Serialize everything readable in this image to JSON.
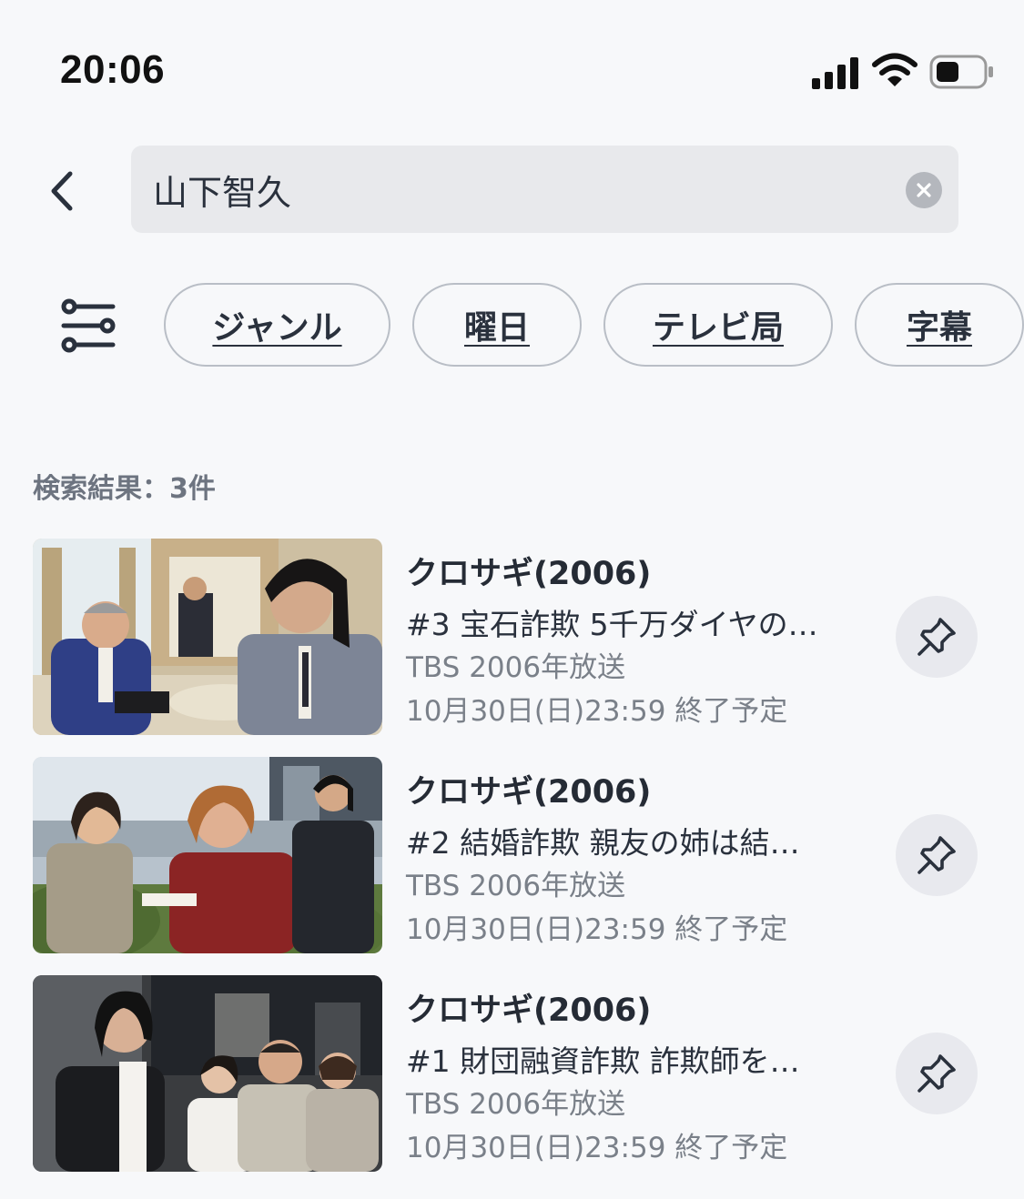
{
  "status_bar": {
    "time": "20:06",
    "icons": [
      "signal-icon",
      "wifi-icon",
      "battery-icon"
    ]
  },
  "header": {
    "back_icon": "chevron-left-icon",
    "search_value": "山下智久",
    "clear_icon": "clear-icon"
  },
  "filters": {
    "filter_icon": "sliders-icon",
    "chips": [
      "ジャンル",
      "曜日",
      "テレビ局",
      "字幕"
    ]
  },
  "results": {
    "count_label": "検索結果：3件",
    "items": [
      {
        "title": "クロサギ(2006)",
        "episode": "#3 宝石詐欺 5千万ダイヤの…",
        "station": "TBS 2006年放送",
        "deadline": "10月30日(日)23:59 終了予定",
        "pin_icon": "pin-icon"
      },
      {
        "title": "クロサギ(2006)",
        "episode": "#2 結婚詐欺 親友の姉は結…",
        "station": "TBS 2006年放送",
        "deadline": "10月30日(日)23:59 終了予定",
        "pin_icon": "pin-icon"
      },
      {
        "title": "クロサギ(2006)",
        "episode": "#1 財団融資詐欺 詐欺師を…",
        "station": "TBS 2006年放送",
        "deadline": "10月30日(日)23:59 終了予定",
        "pin_icon": "pin-icon"
      }
    ]
  },
  "colors": {
    "background": "#f7f8fa",
    "text_primary": "#2a313d",
    "text_secondary": "#7a8089",
    "chip_border": "#b9bec6",
    "search_bg": "#e8e9ec",
    "pin_bg": "#e8e9ee"
  }
}
